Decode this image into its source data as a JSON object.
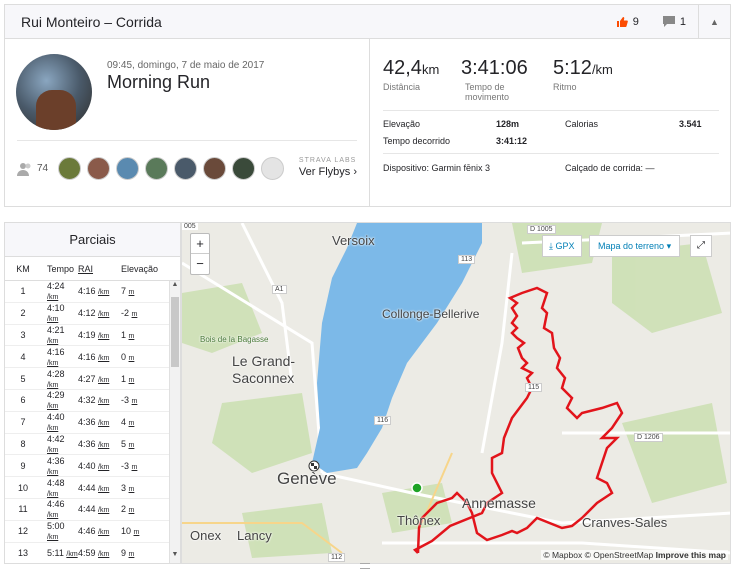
{
  "header": {
    "title": "Rui Monteiro – Corrida",
    "kudos_count": "9",
    "comments_count": "1"
  },
  "activity": {
    "date": "09:45, domingo, 7 de maio de 2017",
    "name": "Morning Run",
    "achievers_count": "74",
    "flyby_lab": "STRAVA LABS",
    "flyby_link": "Ver Flybys"
  },
  "stats": {
    "distance": {
      "value": "42,4",
      "unit": "km",
      "label": "Distância"
    },
    "moving_time": {
      "value": "3:41:06",
      "label1": "Tempo de",
      "label2": "movimento"
    },
    "pace": {
      "value": "5:12",
      "unit": "/km",
      "label": "Ritmo"
    },
    "elevation_label": "Elevação",
    "elevation_value": "128m",
    "elapsed_label": "Tempo decorrido",
    "elapsed_value": "3:41:12",
    "calories_label": "Calorias",
    "calories_value": "3.541",
    "device": "Dispositivo: Garmin fēnix 3",
    "shoes": "Calçado de corrida: —"
  },
  "splits": {
    "title": "Parciais",
    "headers": {
      "km": "KM",
      "pace": "Tempo",
      "gap": "RAI",
      "elev": "Elevação"
    },
    "rows": [
      {
        "km": "1",
        "pace": "4:24",
        "gap": "4:16",
        "elev": "7",
        "elev_unit": "m"
      },
      {
        "km": "2",
        "pace": "4:10",
        "gap": "4:12",
        "elev": "-2",
        "elev_unit": "m"
      },
      {
        "km": "3",
        "pace": "4:21",
        "gap": "4:19",
        "elev": "1",
        "elev_unit": "m"
      },
      {
        "km": "4",
        "pace": "4:16",
        "gap": "4:16",
        "elev": "0",
        "elev_unit": "m"
      },
      {
        "km": "5",
        "pace": "4:28",
        "gap": "4:27",
        "elev": "1",
        "elev_unit": "m"
      },
      {
        "km": "6",
        "pace": "4:29",
        "gap": "4:32",
        "elev": "-3",
        "elev_unit": "m"
      },
      {
        "km": "7",
        "pace": "4:40",
        "gap": "4:36",
        "elev": "4",
        "elev_unit": "m"
      },
      {
        "km": "8",
        "pace": "4:42",
        "gap": "4:36",
        "elev": "5",
        "elev_unit": "m"
      },
      {
        "km": "9",
        "pace": "4:36",
        "gap": "4:40",
        "elev": "-3",
        "elev_unit": "m"
      },
      {
        "km": "10",
        "pace": "4:48",
        "gap": "4:44",
        "elev": "3",
        "elev_unit": "m"
      },
      {
        "km": "11",
        "pace": "4:46",
        "gap": "4:44",
        "elev": "2",
        "elev_unit": "m"
      },
      {
        "km": "12",
        "pace": "5:00",
        "gap": "4:46",
        "elev": "10",
        "elev_unit": "m"
      },
      {
        "km": "13",
        "pace": "5:11",
        "gap": "4:59",
        "elev": "9",
        "elev_unit": "m"
      }
    ],
    "unit": "/km"
  },
  "map": {
    "gpx_label": "GPX",
    "terrain_label": "Mapa do terreno",
    "attribution_mapbox": "© Mapbox",
    "attribution_osm": "© OpenStreetMap",
    "attribution_improve": "Improve this map",
    "labels": {
      "versoix": "Versoix",
      "collonge": "Collonge-Bellerive",
      "grand_saconnex": "Le Grand-\nSaconnex",
      "geneve": "Genève",
      "annemasse": "Annemasse",
      "thonex": "Thônex",
      "cranves": "Cranves-Sales",
      "onex": "Onex",
      "lancy": "Lancy",
      "bagasse": "Bois de la Bagasse",
      "d1005": "D 1005",
      "d1206": "D 1206",
      "r113": "113",
      "r115": "115",
      "r116": "116",
      "a1": "A1",
      "r112": "112",
      "r005": "005"
    },
    "colors": {
      "lake": "#7cb9e8",
      "route": "#e2141b",
      "start": "#1ea326",
      "land": "#ecebe5"
    }
  }
}
